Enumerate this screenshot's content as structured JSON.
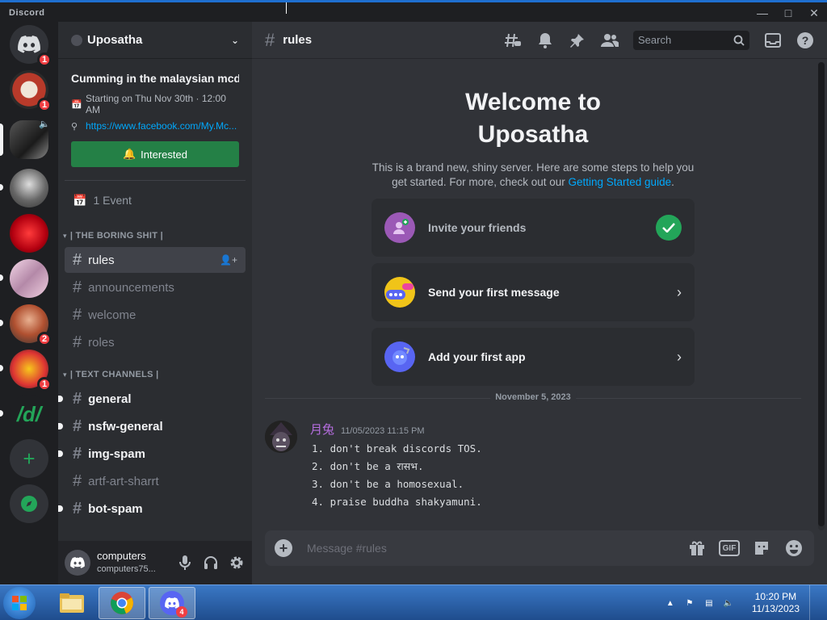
{
  "app": {
    "brand": "Discord"
  },
  "rail": {
    "servers": [
      {
        "name": "home",
        "badge": "1"
      },
      {
        "name": "server-2",
        "badge": "1"
      },
      {
        "name": "server-3",
        "badge": ""
      },
      {
        "name": "server-4",
        "badge": ""
      },
      {
        "name": "server-5",
        "badge": ""
      },
      {
        "name": "server-6",
        "badge": ""
      },
      {
        "name": "server-7",
        "badge": "2"
      },
      {
        "name": "server-8",
        "badge": "1"
      },
      {
        "name": "server-9-text",
        "label": "/d/"
      }
    ]
  },
  "server": {
    "name": "Uposatha",
    "event": {
      "title": "Cumming in the malaysian mcdo",
      "start": "Starting on Thu Nov 30th · 12:00 AM",
      "link": "https://www.facebook.com/My.Mc...",
      "button": "Interested"
    },
    "events_label": "1 Event",
    "categories": [
      {
        "name": "| THE BORING SHIT |",
        "channels": [
          {
            "name": "rules",
            "state": "active"
          },
          {
            "name": "announcements",
            "state": ""
          },
          {
            "name": "welcome",
            "state": ""
          },
          {
            "name": "roles",
            "state": ""
          }
        ]
      },
      {
        "name": "| TEXT CHANNELS |",
        "channels": [
          {
            "name": "general",
            "state": "unread"
          },
          {
            "name": "nsfw-general",
            "state": "unread"
          },
          {
            "name": "img-spam",
            "state": "unread"
          },
          {
            "name": "artf-art-sharrt",
            "state": ""
          },
          {
            "name": "bot-spam",
            "state": "unread"
          }
        ]
      }
    ]
  },
  "user": {
    "name": "computers",
    "sub": "computers75..."
  },
  "channel": {
    "name": "rules",
    "search_placeholder": "Search",
    "welcome": {
      "title_line1": "Welcome to",
      "title_line2": "Uposatha",
      "desc": "This is a brand new, shiny server. Here are some steps to help you get started. For more, check out our ",
      "link": "Getting Started guide",
      "desc_end": "."
    },
    "steps": [
      {
        "label": "Invite your friends",
        "done": true
      },
      {
        "label": "Send your first message",
        "done": false
      },
      {
        "label": "Add your first app",
        "done": false
      }
    ],
    "date_divider": "November 5, 2023",
    "message": {
      "author": "月兔",
      "timestamp": "11/05/2023 11:15 PM",
      "lines": [
        "1. don't break discords TOS.",
        "2. don't be a रासभ.",
        "3. don't be a homosexual.",
        "4. praise buddha shakyamuni."
      ]
    },
    "composer_placeholder": "Message #rules",
    "gif_label": "GIF"
  },
  "taskbar": {
    "time": "10:20 PM",
    "date": "11/13/2023",
    "discord_badge": "4"
  },
  "colors": {
    "accent": "#5865f2",
    "green": "#23a559",
    "interested": "#248046",
    "link": "#00a8fc",
    "badge": "#f23f43",
    "author": "#b66ee0"
  }
}
